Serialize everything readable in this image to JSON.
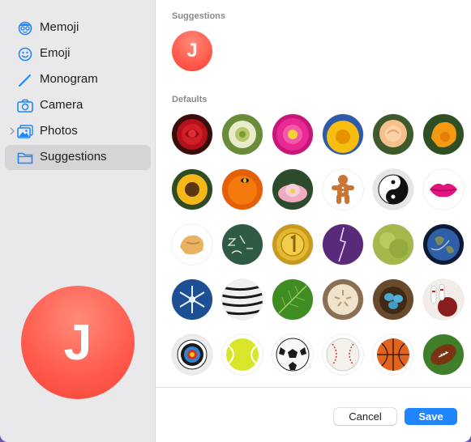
{
  "sidebar": {
    "items": [
      {
        "label": "Memoji",
        "icon": "memoji-icon"
      },
      {
        "label": "Emoji",
        "icon": "emoji-icon"
      },
      {
        "label": "Monogram",
        "icon": "pencil-icon"
      },
      {
        "label": "Camera",
        "icon": "camera-icon"
      },
      {
        "label": "Photos",
        "icon": "photos-icon"
      },
      {
        "label": "Suggestions",
        "icon": "folder-icon",
        "selected": true
      }
    ],
    "preview_initial": "J"
  },
  "main": {
    "suggestions_title": "Suggestions",
    "suggestion_initial": "J",
    "defaults_title": "Defaults",
    "defaults": [
      "red-rose",
      "dandelion",
      "pink-flower",
      "sunflower-yellow",
      "peach-rose",
      "orange-poppy",
      "sunflower",
      "orange-flower-bee",
      "water-lily",
      "gingerbread-man",
      "yin-yang",
      "lips",
      "fortune-cookie",
      "chalkboard",
      "gold-medal",
      "lightning",
      "green-leaves",
      "earth",
      "snowflake",
      "zebra-pattern",
      "green-leaf",
      "sand-dollar",
      "blue-eggs-nest",
      "bowling",
      "target",
      "tennis-ball",
      "soccer-ball",
      "baseball",
      "basketball",
      "football"
    ]
  },
  "footer": {
    "cancel_label": "Cancel",
    "save_label": "Save"
  },
  "colors": {
    "accent": "#1f86ff",
    "avatar": "#ff5a4c",
    "sidebar_bg": "#e9e9eb"
  }
}
